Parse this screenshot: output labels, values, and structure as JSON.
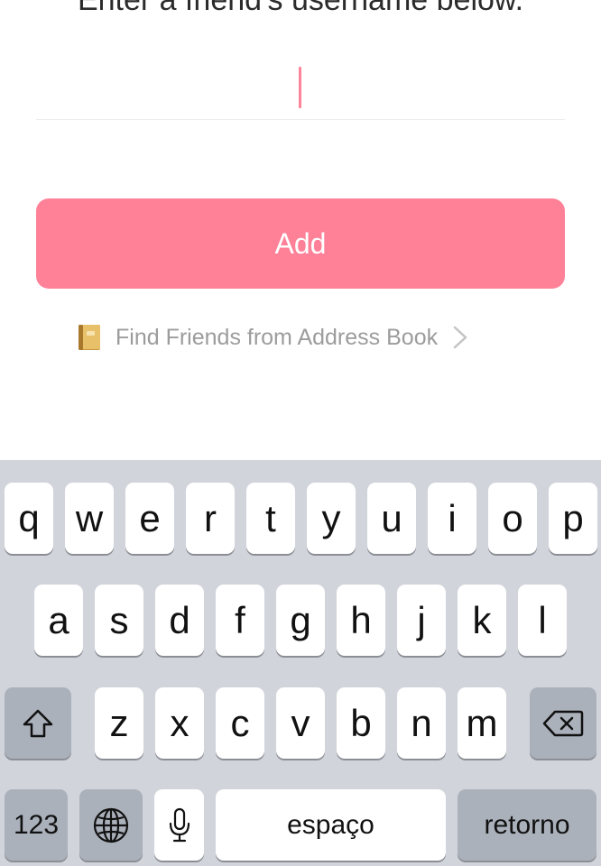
{
  "header": {
    "instruction": "Enter a friend's username below."
  },
  "form": {
    "username_value": "",
    "add_label": "Add",
    "find_friends_label": "Find Friends from Address Book"
  },
  "icons": {
    "address_book": "address-book-icon",
    "chevron": "chevron-right-icon",
    "shift": "shift-icon",
    "backspace": "backspace-icon",
    "globe": "globe-icon",
    "microphone": "microphone-icon"
  },
  "colors": {
    "accent": "#fe8198",
    "caret": "#ff8399",
    "keyboard_bg": "#d1d4db",
    "function_key": "#abb1bb"
  },
  "keyboard": {
    "row1": [
      "q",
      "w",
      "e",
      "r",
      "t",
      "y",
      "u",
      "i",
      "o",
      "p"
    ],
    "row2": [
      "a",
      "s",
      "d",
      "f",
      "g",
      "h",
      "j",
      "k",
      "l"
    ],
    "row3": [
      "z",
      "x",
      "c",
      "v",
      "b",
      "n",
      "m"
    ],
    "numbers_label": "123",
    "space_label": "espaço",
    "return_label": "retorno"
  }
}
